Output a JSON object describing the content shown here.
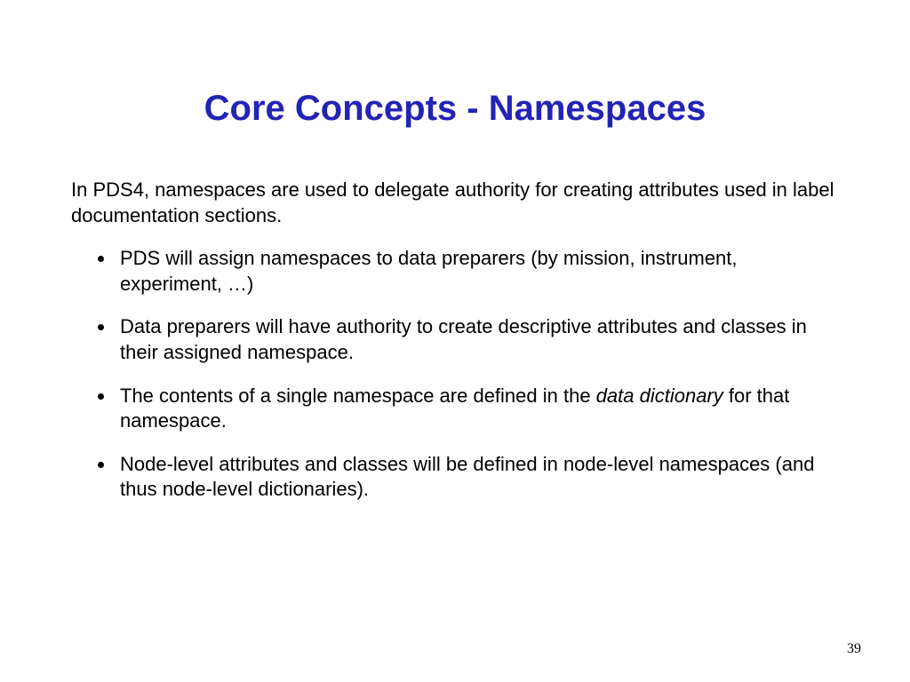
{
  "title": "Core Concepts - Namespaces",
  "intro": "In PDS4, namespaces are used to delegate authority for creating attributes used in label documentation sections.",
  "bullets": {
    "b0": "PDS will assign namespaces to data preparers (by mission, instrument, experiment, …)",
    "b1": "Data preparers will have authority to create descriptive attributes and classes in their assigned namespace.",
    "b2a": "The contents of a single namespace are defined in the ",
    "b2_italic": "data dictionary",
    "b2b": " for that namespace.",
    "b3": "Node-level attributes and classes will be defined in node-level namespaces (and thus node-level dictionaries)."
  },
  "page_number": "39"
}
